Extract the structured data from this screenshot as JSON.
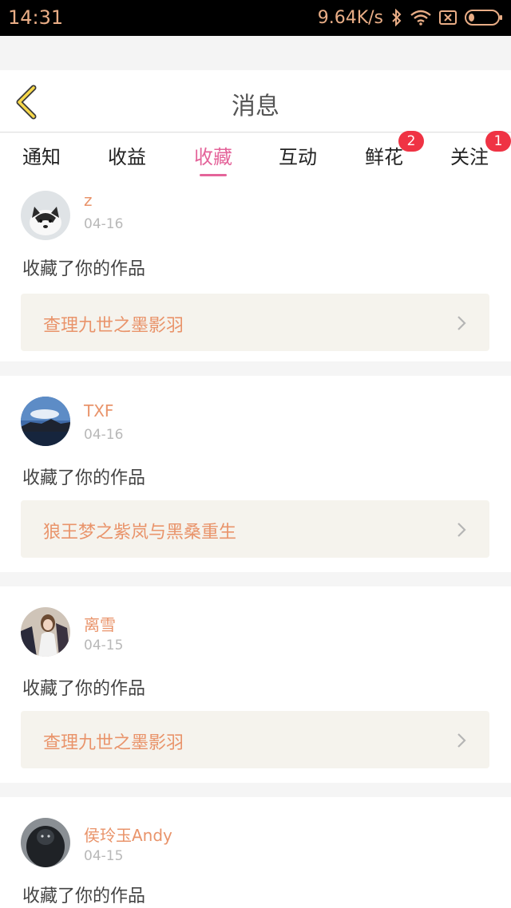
{
  "status_bar": {
    "time": "14:31",
    "net_speed": "9.64K/s",
    "icons": [
      "bluetooth-icon",
      "wifi-icon",
      "sim-off-icon",
      "battery-icon"
    ]
  },
  "header": {
    "back_icon": "chevron-left-icon",
    "title": "消息"
  },
  "tabs": [
    {
      "label": "通知",
      "active": false,
      "badge": ""
    },
    {
      "label": "收益",
      "active": false,
      "badge": ""
    },
    {
      "label": "收藏",
      "active": true,
      "badge": ""
    },
    {
      "label": "互动",
      "active": false,
      "badge": ""
    },
    {
      "label": "鲜花",
      "active": false,
      "badge": "2"
    },
    {
      "label": "关注",
      "active": false,
      "badge": "1"
    }
  ],
  "colors": {
    "accent_pink": "#e4649a",
    "name_orange": "#e9946b",
    "badge_red": "#ef3344",
    "work_bg": "#f5f3ed"
  },
  "messages": [
    {
      "name": "z",
      "date": "04-16",
      "action": "收藏了你的作品",
      "work_title": "查理九世之墨影羽",
      "avatar": "husky-avatar"
    },
    {
      "name": "TXF",
      "date": "04-16",
      "action": "收藏了你的作品",
      "work_title": "狼王梦之紫岚与黑桑重生",
      "avatar": "landscape-avatar"
    },
    {
      "name": "离雪",
      "date": "04-15",
      "action": "收藏了你的作品",
      "work_title": "查理九世之墨影羽",
      "avatar": "girl-avatar"
    },
    {
      "name": "侯玲玉Andy",
      "date": "04-15",
      "action": "收藏了你的作品",
      "work_title": "",
      "avatar": "dark-avatar"
    }
  ]
}
